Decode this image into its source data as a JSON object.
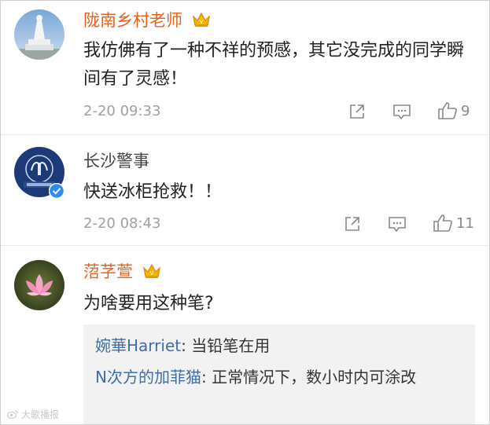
{
  "colors": {
    "vip_username": "#e8621c",
    "normal_username": "#444444",
    "reply_username": "#3f6ea6",
    "meta": "#a0a0a0",
    "reply_box_bg": "#f2f2f2",
    "verified_badge": "#2d8df0"
  },
  "comments": [
    {
      "username": "陇南乡村老师",
      "badge": "crown-icon",
      "text": "我仿佛有了一种不祥的预感，其它没完成的同学瞬间有了灵感！",
      "time": "2-20 09:33",
      "likes": "9"
    },
    {
      "username": "长沙警事",
      "badge": "verified-icon",
      "text": "快送冰柜抢救！！",
      "time": "2-20 08:43",
      "likes": "11"
    },
    {
      "username": "菬芓萱",
      "badge": "crown-icon",
      "text": "为啥要用这种笔?",
      "replies": [
        {
          "user": "婉華Harriet",
          "text": ": 当铅笔在用"
        },
        {
          "user": "N次方的加菲猫",
          "text": ": 正常情况下，数小时内可涂改"
        }
      ]
    }
  ],
  "watermark": "大歌播报"
}
